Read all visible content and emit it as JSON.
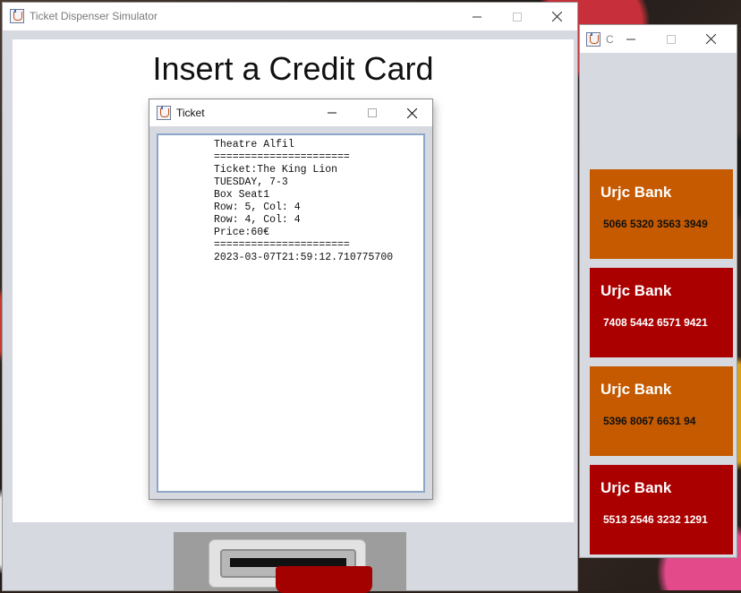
{
  "main_window": {
    "title": "Ticket Dispenser Simulator",
    "heading": "Insert a Credit Card"
  },
  "ticket_window": {
    "title": "Ticket",
    "lines": [
      "Theatre Alfil",
      "======================",
      "Ticket:The King Lion",
      "TUESDAY, 7-3",
      "Box Seat1",
      "Row: 5, Col: 4",
      "Row: 4, Col: 4",
      "Price:60€",
      "======================",
      "2023-03-07T21:59:12.710775700"
    ]
  },
  "card_window": {
    "title": "C",
    "cards": [
      {
        "bank": "Urjc Bank",
        "number": "5066 5320 3563 3949",
        "color": "#c55a00",
        "number_color": "#111111"
      },
      {
        "bank": "Urjc Bank",
        "number": "7408 5442 6571 9421",
        "color": "#aa0000",
        "number_color": "#ffffff"
      },
      {
        "bank": "Urjc Bank",
        "number": "5396 8067 6631 94",
        "color": "#c55a00",
        "number_color": "#111111"
      },
      {
        "bank": "Urjc Bank",
        "number": "5513 2546 3232 1291",
        "color": "#aa0000",
        "number_color": "#ffffff"
      }
    ]
  },
  "controls": {
    "minimize_icon": "minimize-icon",
    "maximize_icon": "maximize-icon",
    "close_icon": "close-icon"
  }
}
